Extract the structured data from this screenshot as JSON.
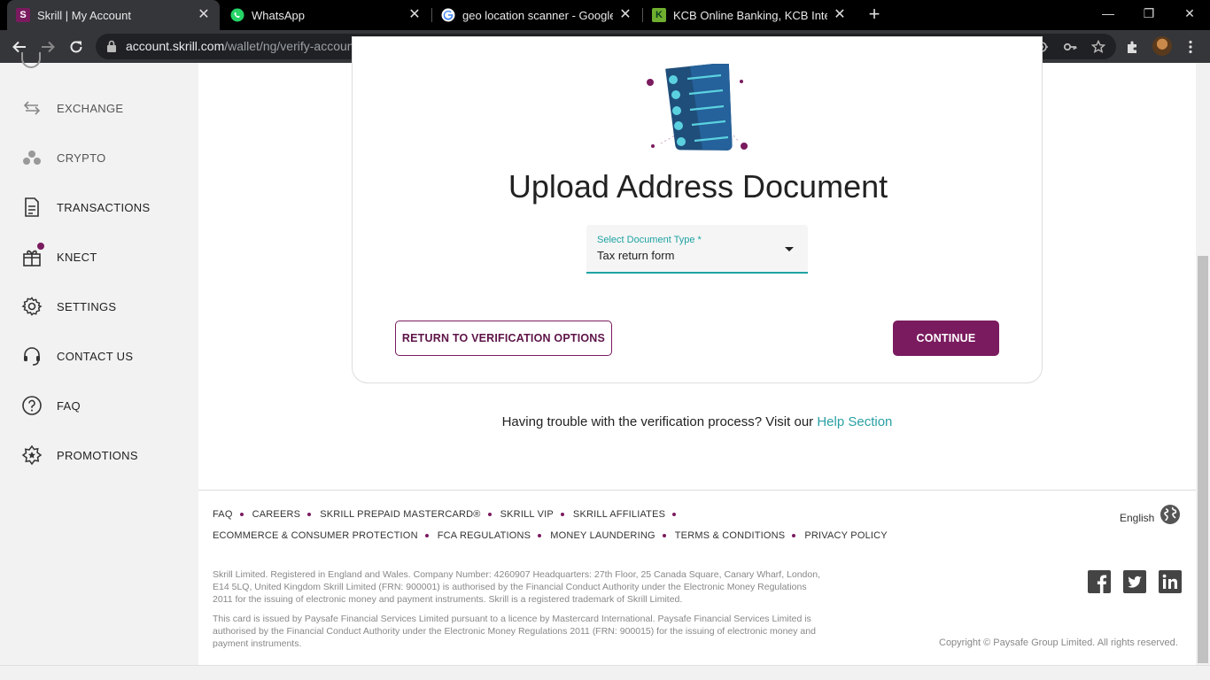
{
  "browser": {
    "tabs": [
      {
        "title": "Skrill | My Account",
        "favicon": "skrill-icon",
        "active": true
      },
      {
        "title": "WhatsApp",
        "favicon": "whatsapp-icon",
        "active": false
      },
      {
        "title": "geo location scanner - Google Se",
        "favicon": "google-icon",
        "active": false
      },
      {
        "title": "KCB Online Banking, KCB Internet",
        "favicon": "kcb-icon",
        "active": false
      }
    ],
    "url_host": "account.skrill.com",
    "url_path": "/wallet/ng/verify-account/address/address-document?fundingReq=false"
  },
  "sidebar": {
    "items": [
      {
        "label": "EXCHANGE",
        "icon": "exchange-icon"
      },
      {
        "label": "CRYPTO",
        "icon": "crypto-icon"
      },
      {
        "label": "TRANSACTIONS",
        "icon": "document-icon"
      },
      {
        "label": "KNECT",
        "icon": "gift-icon"
      },
      {
        "label": "SETTINGS",
        "icon": "gear-icon"
      },
      {
        "label": "CONTACT US",
        "icon": "headset-icon"
      },
      {
        "label": "FAQ",
        "icon": "question-icon"
      },
      {
        "label": "PROMOTIONS",
        "icon": "star-badge-icon"
      }
    ]
  },
  "main": {
    "title": "Upload Address Document",
    "select": {
      "label": "Select Document Type *",
      "value": "Tax return form"
    },
    "return_button": "RETURN TO VERIFICATION OPTIONS",
    "continue_button": "CONTINUE",
    "help_text": "Having trouble with the verification process? Visit our ",
    "help_link": "Help Section"
  },
  "footer": {
    "links_row1": [
      "FAQ",
      "CAREERS",
      "SKRILL PREPAID MASTERCARD®",
      "SKRILL VIP",
      "SKRILL AFFILIATES"
    ],
    "links_row2": [
      "ECOMMERCE & CONSUMER PROTECTION",
      "FCA REGULATIONS",
      "MONEY LAUNDERING",
      "TERMS & CONDITIONS",
      "PRIVACY POLICY"
    ],
    "legal1": "Skrill Limited. Registered in England and Wales. Company Number: 4260907 Headquarters: 27th Floor, 25 Canada Square, Canary Wharf, London, E14 5LQ, United Kingdom Skrill Limited (FRN: 900001) is authorised by the Financial Conduct Authority under the Electronic Money Regulations 2011 for the issuing of electronic money and payment instruments. Skrill is a registered trademark of Skrill Limited.",
    "legal2": "This card is issued by Paysafe Financial Services Limited pursuant to a licence by Mastercard International. Paysafe Financial Services Limited is authorised by the Financial Conduct Authority under the Electronic Money Regulations 2011 (FRN: 900015) for the issuing of electronic money and payment instruments.",
    "language": "English",
    "copyright": "Copyright © Paysafe Group Limited. All rights reserved."
  },
  "colors": {
    "brand": "#7b1b5f",
    "accent": "#2aa0a4"
  }
}
